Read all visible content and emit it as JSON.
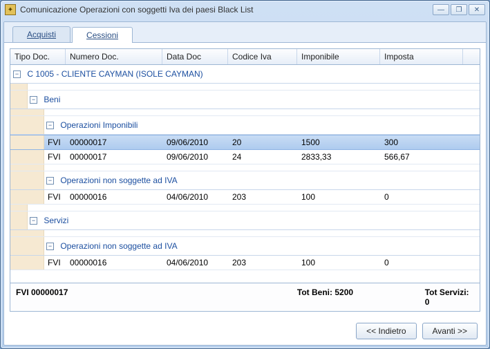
{
  "window": {
    "title": "Comunicazione Operazioni con soggetti Iva dei paesi Black List"
  },
  "tabs": {
    "acquisti": "Acquisti",
    "cessioni": "Cessioni"
  },
  "columns": {
    "c0": "Tipo Doc.",
    "c1": "Numero Doc.",
    "c2": "Data Doc",
    "c3": "Codice Iva",
    "c4": "Imponibile",
    "c5": "Imposta"
  },
  "groups": {
    "cliente": "C 1005 - CLIENTE CAYMAN (ISOLE CAYMAN)",
    "beni": "Beni",
    "op_imp": "Operazioni Imponibili",
    "op_non_iva": "Operazioni non soggette ad IVA",
    "servizi": "Servizi"
  },
  "rows": {
    "r1": {
      "tipo": "FVI",
      "num": "00000017",
      "data": "09/06/2010",
      "cod": "20",
      "imp": "1500",
      "tax": "300"
    },
    "r2": {
      "tipo": "FVI",
      "num": "00000017",
      "data": "09/06/2010",
      "cod": "24",
      "imp": "2833,33",
      "tax": "566,67"
    },
    "r3": {
      "tipo": "FVI",
      "num": "00000016",
      "data": "04/06/2010",
      "cod": "203",
      "imp": "100",
      "tax": "0"
    },
    "r4": {
      "tipo": "FVI",
      "num": "00000016",
      "data": "04/06/2010",
      "cod": "203",
      "imp": "100",
      "tax": "0"
    }
  },
  "footer": {
    "doc": "FVI 00000017",
    "tot_beni": "Tot Beni: 5200",
    "tot_servizi": "Tot Servizi: 0"
  },
  "buttons": {
    "back": "<< Indietro",
    "next": "Avanti >>"
  },
  "glyphs": {
    "minus": "−",
    "minimize": "—",
    "maximize": "❐",
    "close": "✕"
  }
}
